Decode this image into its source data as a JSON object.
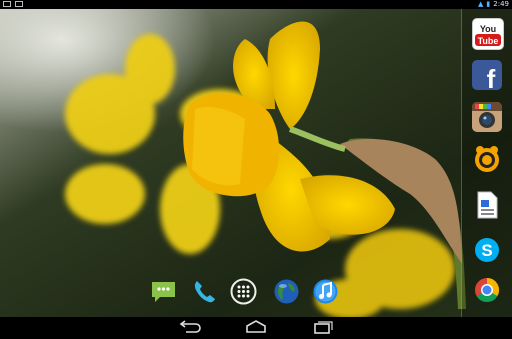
{
  "status_bar": {
    "time": "2:49",
    "left_icons": [
      "notification-icon",
      "image-notification-icon"
    ],
    "right_icons": [
      "wifi-icon",
      "battery-icon"
    ]
  },
  "wallpaper": {
    "subject": "yellow-daffodil"
  },
  "sidebar_apps": [
    {
      "name": "YouTube",
      "label_line1": "You",
      "label_line2": "Tube",
      "icon": "youtube-icon"
    },
    {
      "name": "Facebook",
      "letter": "f",
      "icon": "facebook-icon"
    },
    {
      "name": "Instagram",
      "icon": "instagram-icon"
    },
    {
      "name": "GOM Player",
      "icon": "gom-player-icon"
    },
    {
      "name": "Document Viewer",
      "icon": "document-icon"
    },
    {
      "name": "Skype",
      "letter": "S",
      "icon": "skype-icon"
    },
    {
      "name": "Chrome",
      "icon": "chrome-icon"
    }
  ],
  "dock": [
    {
      "name": "Messaging",
      "icon": "messaging-icon"
    },
    {
      "name": "Phone",
      "icon": "phone-icon"
    },
    {
      "name": "All Apps",
      "icon": "app-drawer-icon"
    },
    {
      "name": "Browser",
      "icon": "globe-icon"
    },
    {
      "name": "Music",
      "icon": "music-icon"
    }
  ],
  "nav_bar": {
    "buttons": [
      "back-button",
      "home-button",
      "recents-button"
    ]
  },
  "colors": {
    "flower": "#f4c40a",
    "accent_blue": "#33b5e5"
  }
}
